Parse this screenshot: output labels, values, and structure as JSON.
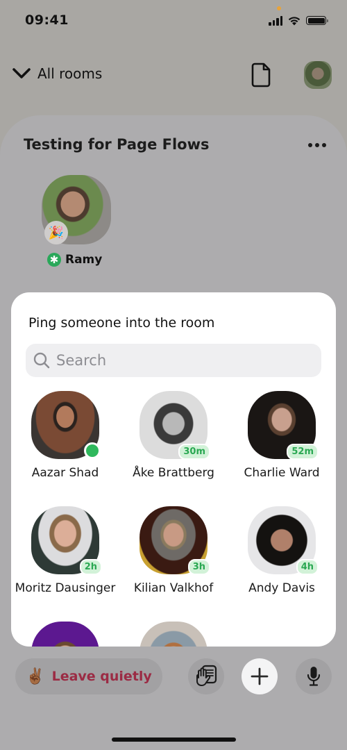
{
  "status_bar": {
    "time": "09:41"
  },
  "header": {
    "rooms_label": "All rooms"
  },
  "room": {
    "title": "Testing for Page Flows",
    "participants": [
      {
        "name": "Ramy",
        "reaction": "🎉"
      }
    ]
  },
  "ping_sheet": {
    "title": "Ping someone into the room",
    "search": {
      "placeholder": "Search",
      "value": ""
    },
    "people": [
      {
        "name": "Aazar Shad",
        "status": "online",
        "badge": ""
      },
      {
        "name": "Åke Brattberg",
        "status": "away",
        "badge": "30m"
      },
      {
        "name": "Charlie Ward",
        "status": "away",
        "badge": "52m"
      },
      {
        "name": "Moritz Dausinger",
        "status": "away",
        "badge": "2h"
      },
      {
        "name": "Kilian Valkhof",
        "status": "away",
        "badge": "3h"
      },
      {
        "name": "Andy Davis",
        "status": "away",
        "badge": "4h"
      },
      {
        "name": "",
        "status": "",
        "badge": ""
      },
      {
        "name": "",
        "status": "",
        "badge": ""
      }
    ]
  },
  "bottom_bar": {
    "leave_emoji": "✌🏾",
    "leave_label": "Leave quietly"
  },
  "colors": {
    "online": "#2fb85c",
    "badge_text": "#2aa852",
    "badge_bg": "#d2f2d8",
    "leave_text": "#9b2b44",
    "ramy_badge": "#2aa85a"
  }
}
